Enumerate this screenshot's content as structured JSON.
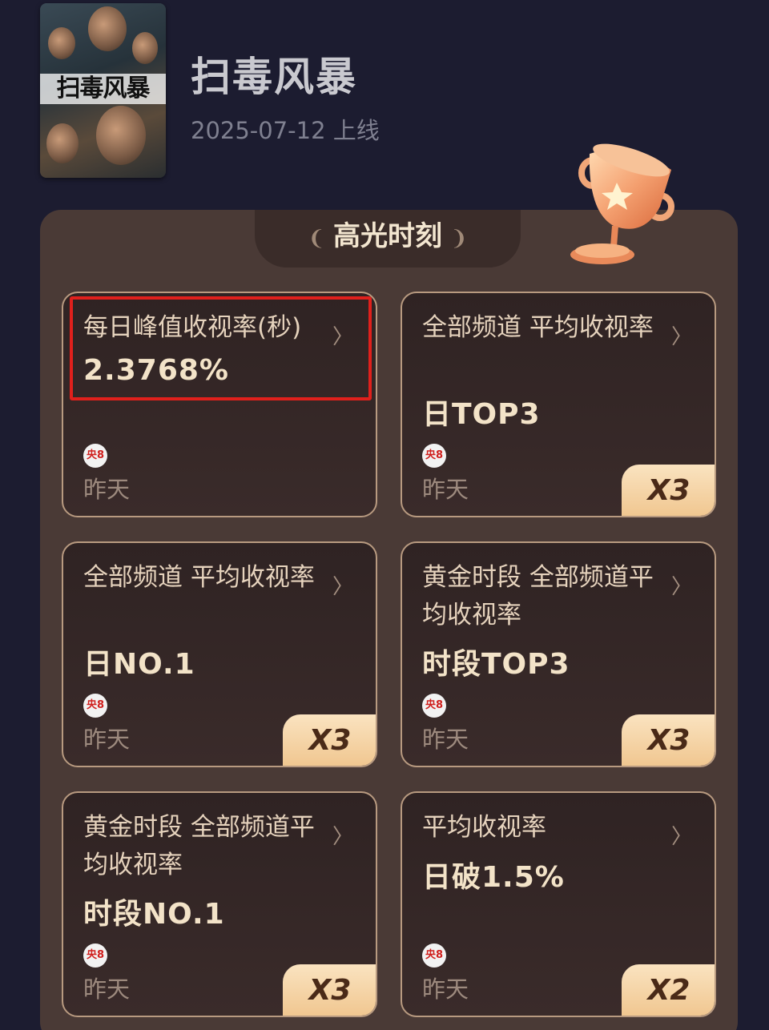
{
  "header": {
    "poster_text": "扫毒风暴",
    "title": "扫毒风暴",
    "date": "2025-07-12 上线"
  },
  "panel": {
    "title": "高光时刻"
  },
  "cards": [
    {
      "label": "每日峰值收视率(秒)",
      "value": "2.3768%",
      "channel": "央8",
      "day": "昨天",
      "badge": ""
    },
    {
      "label": "全部频道 平均收视率",
      "value": "日TOP3",
      "channel": "央8",
      "day": "昨天",
      "badge": "X3"
    },
    {
      "label": "全部频道 平均收视率",
      "value": "日NO.1",
      "channel": "央8",
      "day": "昨天",
      "badge": "X3"
    },
    {
      "label": "黄金时段 全部频道平均收视率",
      "value": "时段TOP3",
      "channel": "央8",
      "day": "昨天",
      "badge": "X3"
    },
    {
      "label": "黄金时段 全部频道平均收视率",
      "value": "时段NO.1",
      "channel": "央8",
      "day": "昨天",
      "badge": "X3"
    },
    {
      "label": "平均收视率",
      "value": "日破1.5%",
      "channel": "央8",
      "day": "昨天",
      "badge": "X2"
    }
  ]
}
